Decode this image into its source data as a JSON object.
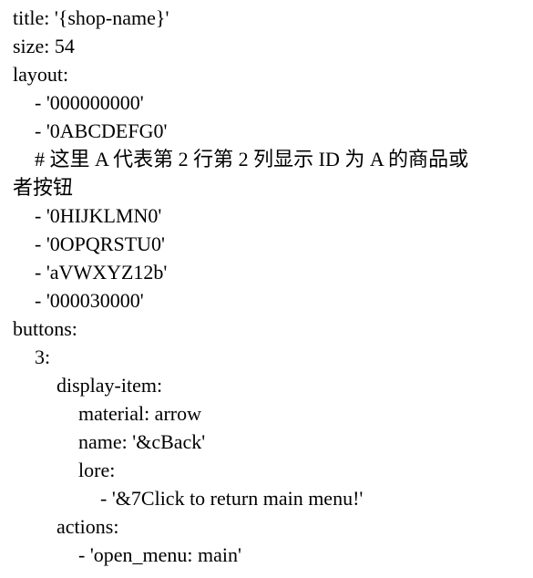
{
  "document": {
    "lines": [
      "title: '{shop-name}'",
      "size: 54",
      "layout:",
      "- '000000000'",
      "- '0ABCDEFG0'",
      "# 这里 A 代表第 2 行第 2 列显示 ID 为 A 的商品或",
      "者按钮",
      "- '0HIJKLMN0'",
      "- '0OPQRSTU0'",
      "- 'aVWXYZ12b'",
      "- '000030000'",
      "buttons:",
      "3:",
      "display-item:",
      "material: arrow",
      "name: '&cBack'",
      "lore:",
      "- '&7Click to return main menu!'",
      "actions:",
      "- 'open_menu: main'"
    ]
  }
}
